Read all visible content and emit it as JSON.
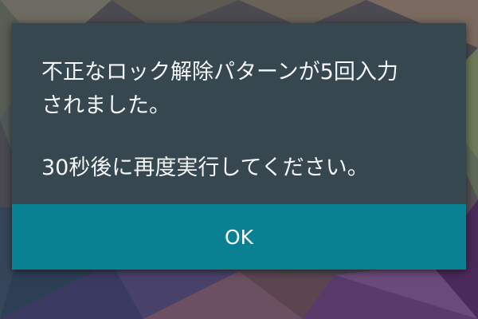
{
  "dialog": {
    "message_line1": "不正なロック解除パターンが5回入力",
    "message_line2": "されました。",
    "message_line3": "30秒後に再度実行してください。",
    "ok_label": "OK"
  },
  "colors": {
    "dialog_background": "#37474f",
    "button_background": "#0a8193",
    "text": "#f4f6f7"
  },
  "icons": {
    "wallpaper": "polygon-wallpaper"
  }
}
